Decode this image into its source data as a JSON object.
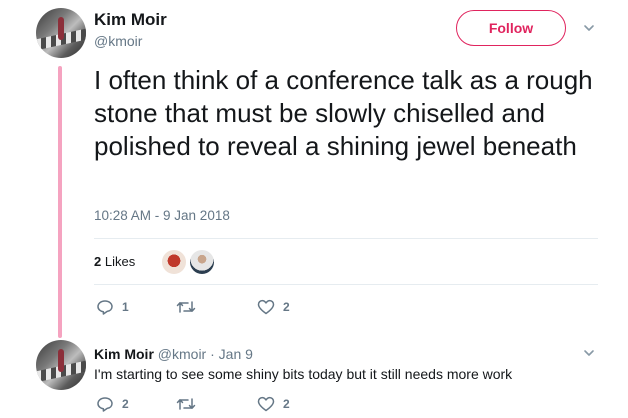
{
  "main_tweet": {
    "author_name": "Kim Moir",
    "author_handle": "@kmoir",
    "follow_label": "Follow",
    "text": "I often think of a conference talk as a rough stone that must be slowly chiselled and polished to reveal a shining jewel beneath",
    "timestamp": "10:28 AM - 9 Jan 2018",
    "likes_count": "2",
    "likes_label": "Likes",
    "actions": {
      "reply_count": "1",
      "retweet_count": "",
      "like_count": "2"
    }
  },
  "reply_tweet": {
    "author_name": "Kim Moir",
    "author_handle": "@kmoir",
    "separator": "·",
    "date": "Jan 9",
    "text": "I'm starting to see some shiny bits today but it still needs more work",
    "actions": {
      "reply_count": "2",
      "retweet_count": "",
      "like_count": "2"
    }
  },
  "icons": [
    "chevron-down-icon",
    "reply-icon",
    "retweet-icon",
    "heart-icon"
  ],
  "colors": {
    "accent": "#e0245e",
    "thread_line": "#f5a3c0",
    "secondary_text": "#657786",
    "primary_text": "#14171a",
    "divider": "#e6ecf0"
  }
}
